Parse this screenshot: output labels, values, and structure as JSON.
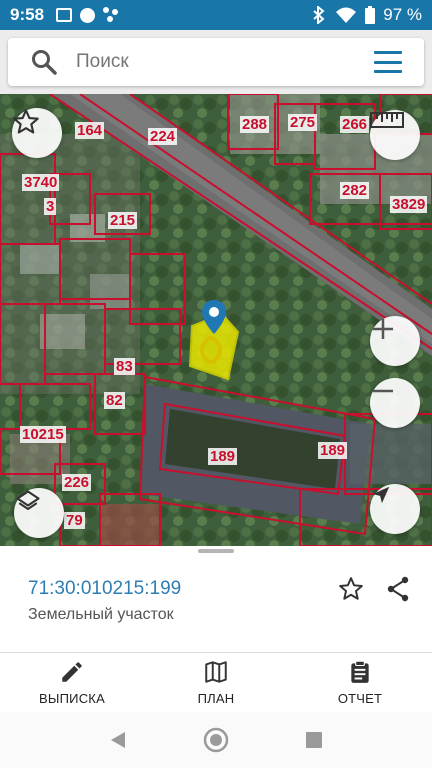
{
  "status_bar": {
    "time": "9:58",
    "battery": "97 %",
    "left_icons": [
      "mail-icon",
      "circle-icon",
      "dots-icon"
    ],
    "right_icons": [
      "bluetooth-icon",
      "wifi-icon",
      "battery-icon"
    ]
  },
  "search": {
    "placeholder": "Поиск"
  },
  "map": {
    "labels": [
      "164",
      "224",
      "288",
      "275",
      "266",
      "3740",
      "3",
      "215",
      "282",
      "3829",
      "83",
      "82",
      "10215",
      "189",
      "189",
      "226",
      "79"
    ],
    "controls": [
      "favorite-star-icon",
      "ruler-icon",
      "zoom-in-icon",
      "zoom-out-icon",
      "layers-icon",
      "my-location-icon"
    ]
  },
  "parcel": {
    "cadastral_number": "71:30:010215:199",
    "type": "Земельный участок"
  },
  "bottom_nav": {
    "items": [
      {
        "label": "ВЫПИСКА",
        "icon": "pencil-icon"
      },
      {
        "label": "ПЛАН",
        "icon": "map-icon"
      },
      {
        "label": "ОТЧЕТ",
        "icon": "clipboard-icon"
      }
    ]
  },
  "colors": {
    "accent": "#1976a8",
    "link": "#2f7eb3",
    "boundary": "#c8102e",
    "selected_parcel": "#e8e600"
  }
}
